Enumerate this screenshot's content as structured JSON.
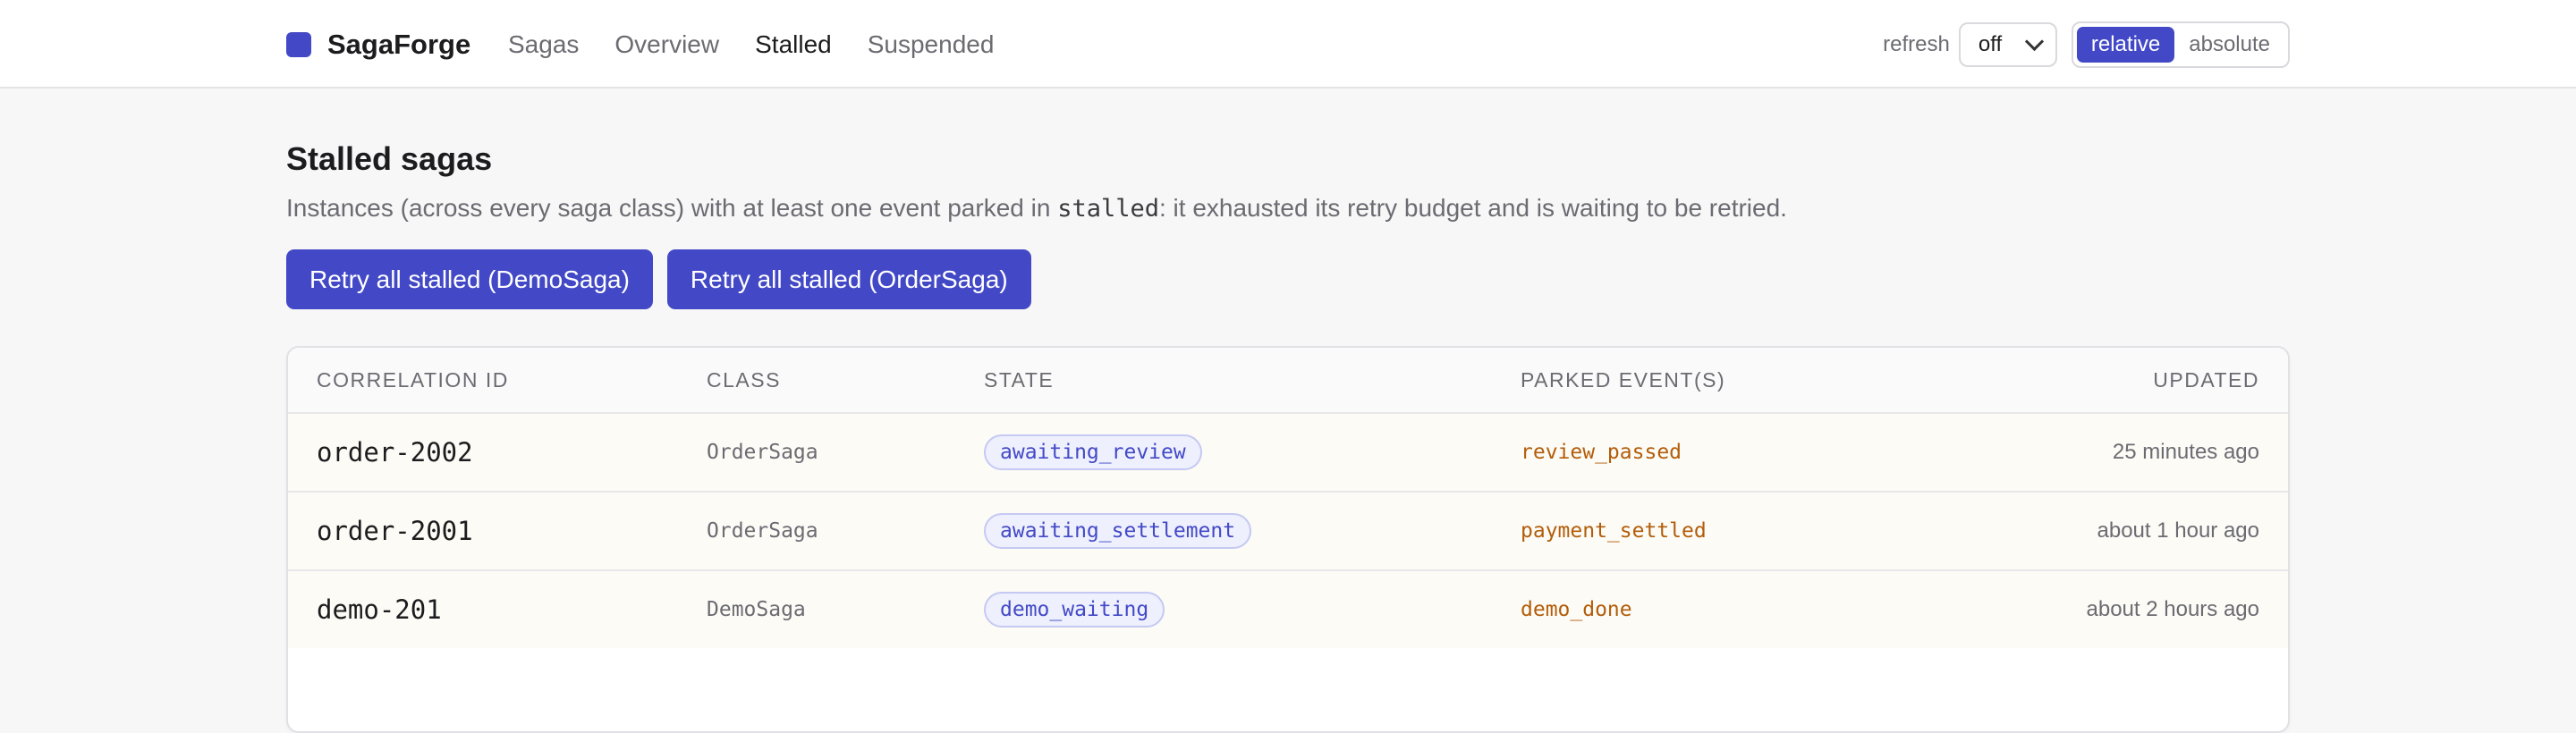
{
  "app": {
    "name": "SagaForge",
    "accent": "#4349c6"
  },
  "nav": [
    {
      "label": "Sagas",
      "active": false
    },
    {
      "label": "Overview",
      "active": false
    },
    {
      "label": "Stalled",
      "active": true
    },
    {
      "label": "Suspended",
      "active": false
    }
  ],
  "controls": {
    "refresh_label": "refresh",
    "refresh_value": "off",
    "time_modes": [
      "relative",
      "absolute"
    ],
    "time_mode_selected": "relative"
  },
  "page": {
    "title": "Stalled sagas",
    "description_before": "Instances (across every saga class) with at least one event parked in ",
    "description_code": "stalled",
    "description_after": ": it exhausted its retry budget and is waiting to be retried."
  },
  "actions": [
    {
      "label": "Retry all stalled (DemoSaga)"
    },
    {
      "label": "Retry all stalled (OrderSaga)"
    }
  ],
  "table": {
    "headers": {
      "correlation_id": "CORRELATION ID",
      "class": "CLASS",
      "state": "STATE",
      "parked": "PARKED EVENT(S)",
      "updated": "UPDATED"
    },
    "rows": [
      {
        "correlation_id": "order-2002",
        "class": "OrderSaga",
        "state": "awaiting_review",
        "parked": "review_passed",
        "updated": "25 minutes ago"
      },
      {
        "correlation_id": "order-2001",
        "class": "OrderSaga",
        "state": "awaiting_settlement",
        "parked": "payment_settled",
        "updated": "about 1 hour ago"
      },
      {
        "correlation_id": "demo-201",
        "class": "DemoSaga",
        "state": "demo_waiting",
        "parked": "demo_done",
        "updated": "about 2 hours ago"
      }
    ]
  }
}
